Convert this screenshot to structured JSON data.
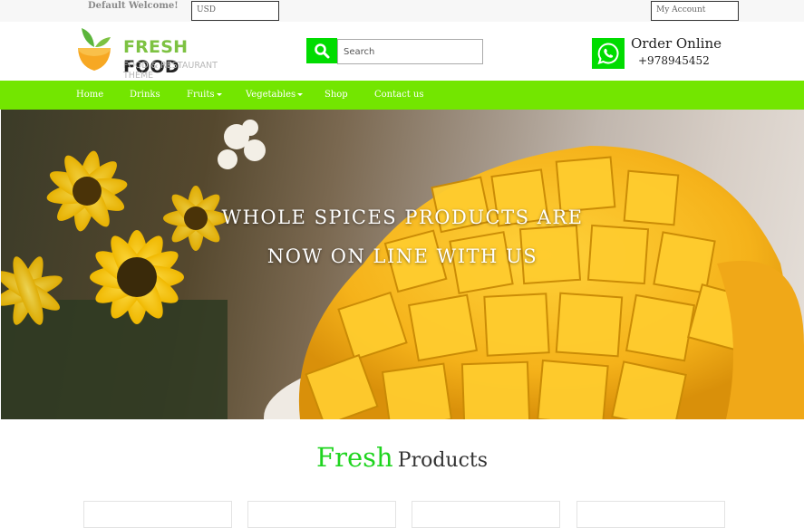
{
  "topbar": {
    "welcome": "Default Welcome!",
    "currency": "USD",
    "account": "My Account"
  },
  "header": {
    "logo_word1": "FRESH",
    "logo_word2": "FOOD",
    "logo_tagline": "FOOD & RESTAURANT THEME",
    "search_placeholder": "Search",
    "order_title": "Order Online",
    "order_phone": "+978945452"
  },
  "nav": {
    "items": [
      {
        "label": "Home"
      },
      {
        "label": "Drinks"
      },
      {
        "label": "Fruits"
      },
      {
        "label": "Vegetables"
      },
      {
        "label": "Shop"
      },
      {
        "label": "Contact us"
      }
    ]
  },
  "hero": {
    "line1": "WHOLE SPICES PRODUCTS ARE",
    "line2": "NOW ON LINE WITH US"
  },
  "products": {
    "title_accent": "Fresh",
    "title_rest": "Products"
  },
  "colors": {
    "accent_green": "#73e600",
    "button_green": "#00dc00",
    "title_green": "#1fd41f"
  },
  "icons": [
    "search-icon",
    "whatsapp-icon",
    "logo-leaf-bowl-icon",
    "caret-down-icon"
  ]
}
